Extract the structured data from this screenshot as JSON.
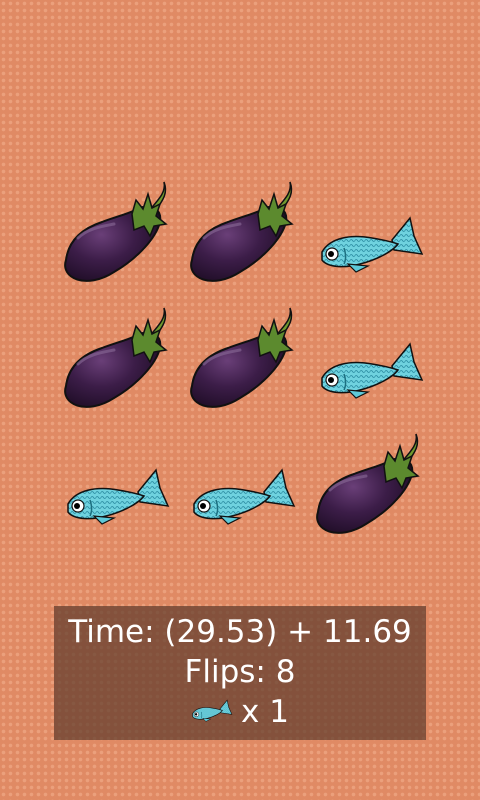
{
  "board": {
    "tiles": [
      {
        "kind": "eggplant",
        "icon": "eggplant-icon"
      },
      {
        "kind": "eggplant",
        "icon": "eggplant-icon"
      },
      {
        "kind": "fish",
        "icon": "fish-icon"
      },
      {
        "kind": "eggplant",
        "icon": "eggplant-icon"
      },
      {
        "kind": "eggplant",
        "icon": "eggplant-icon"
      },
      {
        "kind": "fish",
        "icon": "fish-icon"
      },
      {
        "kind": "fish",
        "icon": "fish-icon"
      },
      {
        "kind": "fish",
        "icon": "fish-icon"
      },
      {
        "kind": "eggplant",
        "icon": "eggplant-icon"
      }
    ]
  },
  "status": {
    "time_text": "Time: (29.53) + 11.69",
    "flips_text": "Flips: 8",
    "fish_count_text": "x 1",
    "fish_icon": "fish-icon"
  },
  "colors": {
    "background": "#e08a64",
    "panel": "#5f3c2d",
    "eggplant": "#3a1c45",
    "eggplant_stem": "#5c8a2e",
    "fish": "#5ec9d8"
  }
}
